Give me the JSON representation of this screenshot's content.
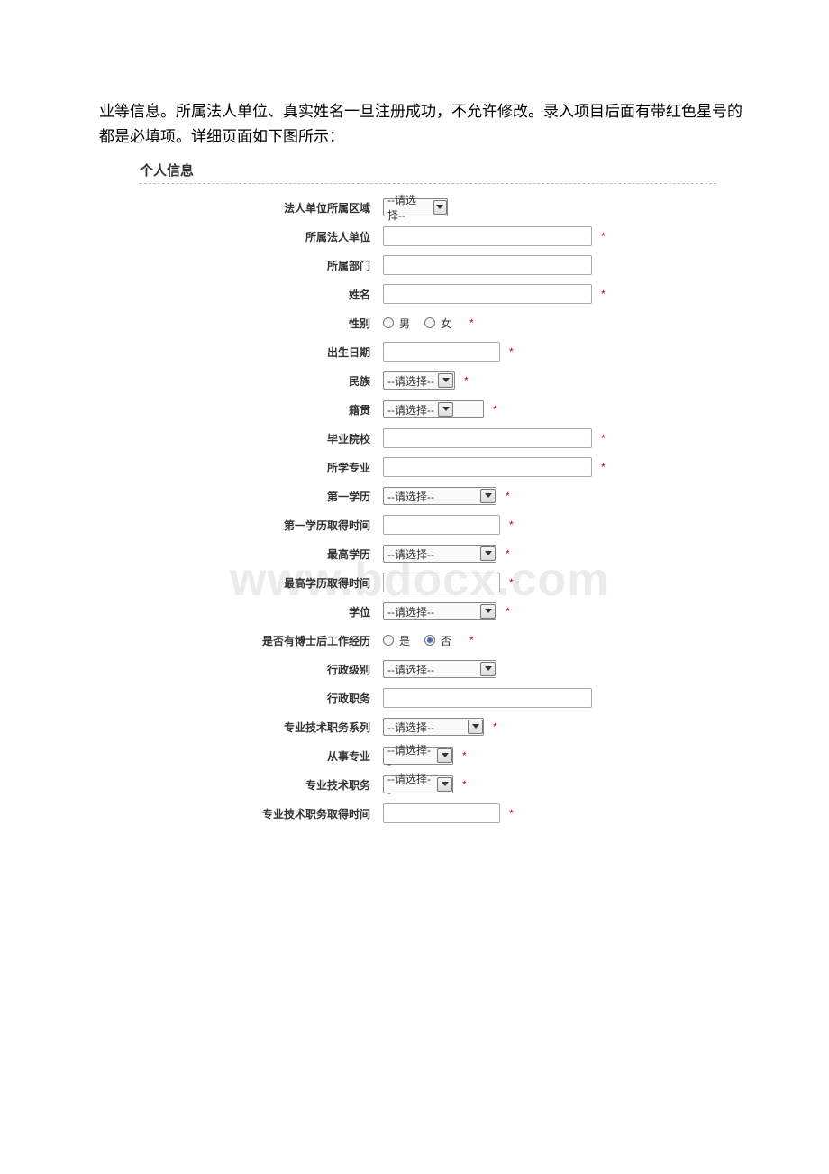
{
  "intro": "业等信息。所属法人单位、真实姓名一旦注册成功，不允许修改。录入项目后面有带红色星号的都是必填项。详细页面如下图所示：",
  "section_title": "个人信息",
  "placeholder_select": "--请选择--",
  "req": "*",
  "watermark": "www.bdocx.com",
  "labels": {
    "region": "法人单位所属区域",
    "unit": "所属法人单位",
    "dept": "所属部门",
    "name": "姓名",
    "gender": "性别",
    "birth": "出生日期",
    "ethnic": "民族",
    "native": "籍贯",
    "school": "毕业院校",
    "major": "所学专业",
    "first_edu": "第一学历",
    "first_edu_time": "第一学历取得时间",
    "highest_edu": "最高学历",
    "highest_edu_time": "最高学历取得时间",
    "degree": "学位",
    "postdoc": "是否有博士后工作经历",
    "admin_level": "行政级别",
    "admin_duty": "行政职务",
    "tech_series": "专业技术职务系列",
    "engaged_major": "从事专业",
    "tech_duty": "专业技术职务",
    "tech_duty_time": "专业技术职务取得时间"
  },
  "gender": {
    "male": "男",
    "female": "女"
  },
  "postdoc": {
    "yes": "是",
    "no": "否"
  }
}
